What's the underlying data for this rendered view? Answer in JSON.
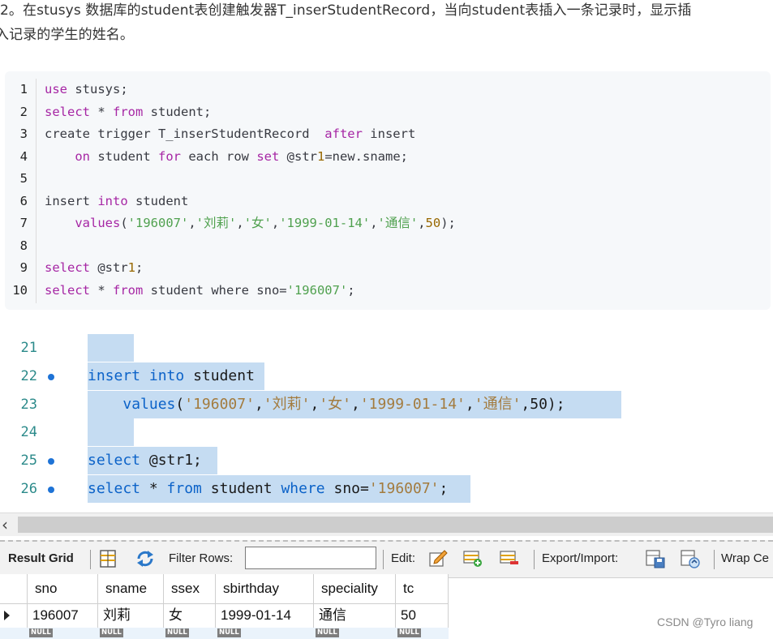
{
  "intro": {
    "line1": "2。在stusys 数据库的student表创建触发器T_inserStudentRecord，当向student表插入一条记录时，显示插",
    "line2": "入记录的学生的姓名。"
  },
  "code": [
    {
      "n": "1",
      "parts": [
        [
          "kw",
          "use"
        ],
        [
          "plain",
          " stusys;"
        ]
      ]
    },
    {
      "n": "2",
      "parts": [
        [
          "kw",
          "select"
        ],
        [
          "plain",
          " * "
        ],
        [
          "kw",
          "from"
        ],
        [
          "plain",
          " student;"
        ]
      ]
    },
    {
      "n": "3",
      "parts": [
        [
          "plain",
          "create trigger T_inserStudentRecord  "
        ],
        [
          "kw",
          "after"
        ],
        [
          "plain",
          " insert"
        ]
      ]
    },
    {
      "n": "4",
      "parts": [
        [
          "plain",
          "    "
        ],
        [
          "kw",
          "on"
        ],
        [
          "plain",
          " student "
        ],
        [
          "kw",
          "for"
        ],
        [
          "plain",
          " each row "
        ],
        [
          "kw",
          "set"
        ],
        [
          "plain",
          " @str"
        ],
        [
          "num",
          "1"
        ],
        [
          "plain",
          "=new.sname;"
        ]
      ]
    },
    {
      "n": "5",
      "parts": []
    },
    {
      "n": "6",
      "parts": [
        [
          "plain",
          "insert "
        ],
        [
          "kw",
          "into"
        ],
        [
          "plain",
          " student"
        ]
      ]
    },
    {
      "n": "7",
      "parts": [
        [
          "plain",
          "    "
        ],
        [
          "kw",
          "values"
        ],
        [
          "plain",
          "("
        ],
        [
          "str",
          "'196007'"
        ],
        [
          "plain",
          ","
        ],
        [
          "str",
          "'刘莉'"
        ],
        [
          "plain",
          ","
        ],
        [
          "str",
          "'女'"
        ],
        [
          "plain",
          ","
        ],
        [
          "str",
          "'1999-01-14'"
        ],
        [
          "plain",
          ","
        ],
        [
          "str",
          "'通信'"
        ],
        [
          "plain",
          ","
        ],
        [
          "num",
          "50"
        ],
        [
          "plain",
          ");"
        ]
      ]
    },
    {
      "n": "8",
      "parts": []
    },
    {
      "n": "9",
      "parts": [
        [
          "kw",
          "select"
        ],
        [
          "plain",
          " @str"
        ],
        [
          "num",
          "1"
        ],
        [
          "plain",
          ";"
        ]
      ]
    },
    {
      "n": "10",
      "parts": [
        [
          "kw",
          "select"
        ],
        [
          "plain",
          " * "
        ],
        [
          "kw",
          "from"
        ],
        [
          "plain",
          " student where sno="
        ],
        [
          "str",
          "'196007'"
        ],
        [
          "plain",
          ";"
        ]
      ]
    }
  ],
  "editor": [
    {
      "n": "21",
      "dot": false,
      "parts": []
    },
    {
      "n": "22",
      "dot": true,
      "parts": [
        [
          "ekw",
          "insert"
        ],
        [
          "edef",
          " "
        ],
        [
          "ekw",
          "into"
        ],
        [
          "edef",
          " student"
        ]
      ]
    },
    {
      "n": "23",
      "dot": false,
      "parts": [
        [
          "edef",
          "    "
        ],
        [
          "ekw",
          "values"
        ],
        [
          "edef",
          "("
        ],
        [
          "estr",
          "'196007'"
        ],
        [
          "edef",
          ","
        ],
        [
          "estr",
          "'刘莉'"
        ],
        [
          "edef",
          ","
        ],
        [
          "estr",
          "'女'"
        ],
        [
          "edef",
          ","
        ],
        [
          "estr",
          "'1999-01-14'"
        ],
        [
          "edef",
          ","
        ],
        [
          "estr",
          "'通信'"
        ],
        [
          "edef",
          ",50);"
        ]
      ]
    },
    {
      "n": "24",
      "dot": false,
      "parts": []
    },
    {
      "n": "25",
      "dot": true,
      "parts": [
        [
          "ekw",
          "select"
        ],
        [
          "edef",
          " @str1;"
        ]
      ]
    },
    {
      "n": "26",
      "dot": true,
      "parts": [
        [
          "ekw",
          "select"
        ],
        [
          "edef",
          " * "
        ],
        [
          "ekw",
          "from"
        ],
        [
          "edef",
          " student "
        ],
        [
          "ekw",
          "where"
        ],
        [
          "edef",
          " sno="
        ],
        [
          "estr",
          "'196007'"
        ],
        [
          "edef",
          ";"
        ]
      ]
    }
  ],
  "scroll": {
    "left_arrow": "‹"
  },
  "toolbar": {
    "result_grid": "Result Grid",
    "filter_rows": "Filter Rows:",
    "filter_value": "",
    "edit": "Edit:",
    "export_import": "Export/Import:",
    "wrap": "Wrap Ce"
  },
  "grid": {
    "columns": [
      "sno",
      "sname",
      "ssex",
      "sbirthday",
      "speciality",
      "tc"
    ],
    "row": [
      "196007",
      "刘莉",
      "女",
      "1999-01-14",
      "通信",
      "50"
    ],
    "null_label": "NULL"
  },
  "watermark": "CSDN @Tyro liang"
}
